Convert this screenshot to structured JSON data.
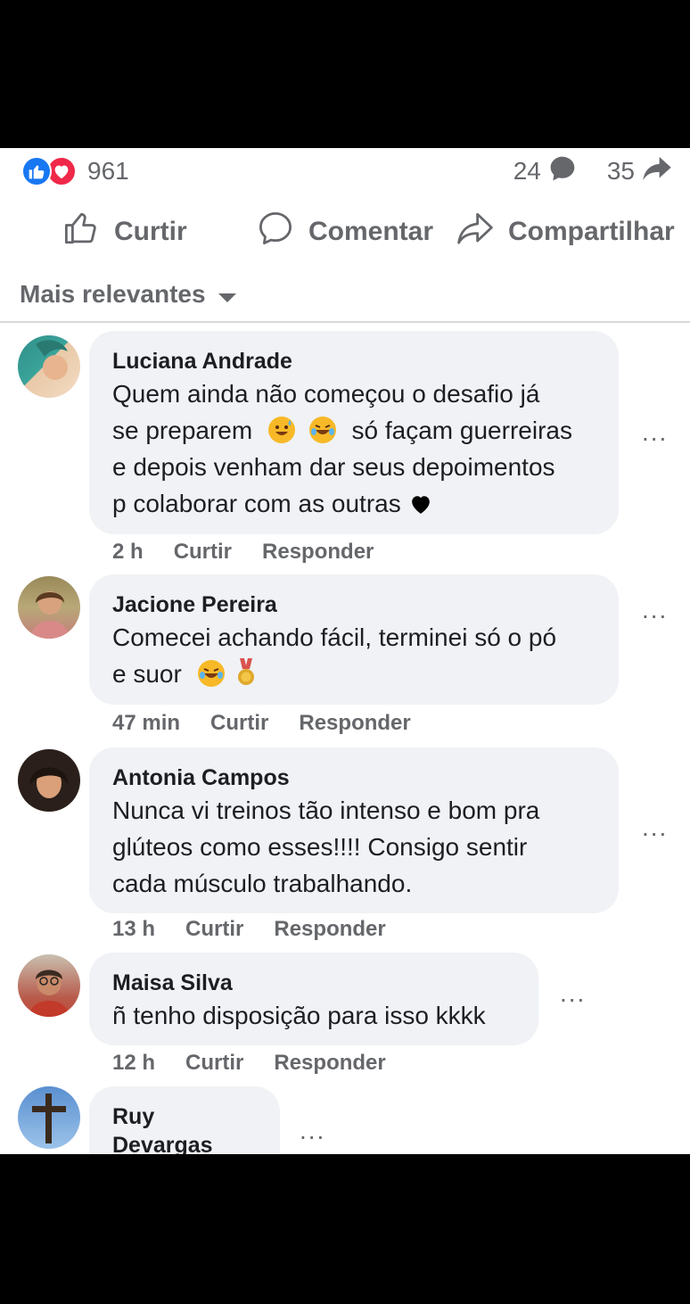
{
  "post": {
    "reaction_count": "961",
    "comment_count": "24",
    "share_count": "35",
    "actions": {
      "like": "Curtir",
      "comment": "Comentar",
      "share": "Compartilhar"
    },
    "sort_label": "Mais relevantes"
  },
  "colors": {
    "like_blue": "#1877f2",
    "love_red": "#f02849",
    "bubble_bg": "#f0f2f5",
    "secondary_text": "#65676b"
  },
  "comments": [
    {
      "author": "Luciana Andrade",
      "text_lines": [
        "Quem ainda não começou o desafio já",
        "se preparem",
        "só façam guerreiras",
        "e depois venham dar seus depoimentos",
        "p colaborar com as outras"
      ],
      "time": "2 h",
      "like_label": "Curtir",
      "reply_label": "Responder",
      "more": "..."
    },
    {
      "author": "Jacione Pereira",
      "text_lines": [
        "Comecei achando fácil, terminei só o pó",
        "e suor"
      ],
      "time": "47 min",
      "like_label": "Curtir",
      "reply_label": "Responder",
      "more": "..."
    },
    {
      "author": "Antonia Campos",
      "text_lines": [
        "Nunca vi treinos tão intenso e bom pra",
        "glúteos como esses!!!! Consigo sentir",
        "cada músculo trabalhando."
      ],
      "time": "13 h",
      "like_label": "Curtir",
      "reply_label": "Responder",
      "more": "..."
    },
    {
      "author": "Maisa Silva",
      "text_lines": [
        "ñ tenho disposição para isso kkkk"
      ],
      "time": "12 h",
      "like_label": "Curtir",
      "reply_label": "Responder",
      "more": "..."
    },
    {
      "author": "Ruy Devargas",
      "text_lines": [],
      "more": "..."
    }
  ]
}
